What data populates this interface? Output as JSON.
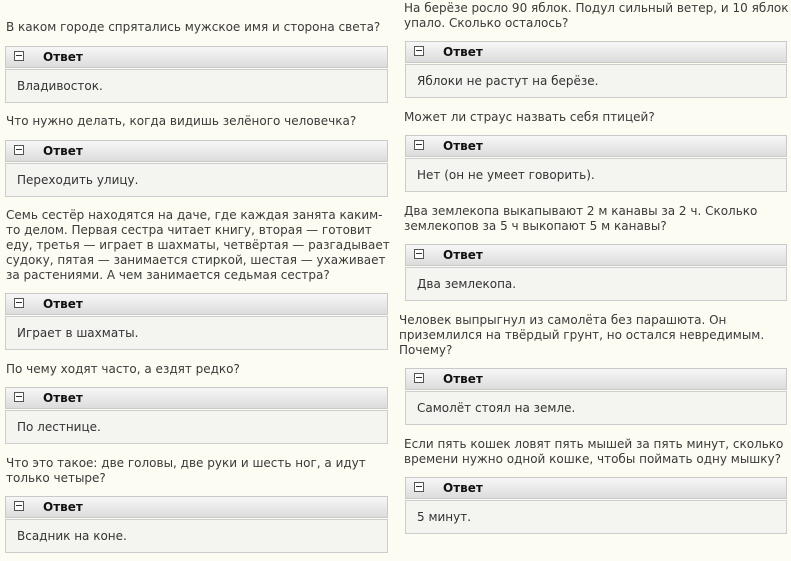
{
  "answer_label": "Ответ",
  "left": [
    {
      "question": "В каком городе спрятались мужское имя и сторона света?",
      "answer": "Владивосток."
    },
    {
      "question": "Что нужно делать, когда видишь зелёного человечка?",
      "answer": "Переходить улицу."
    },
    {
      "question": "Семь сестёр находятся на даче, где каждая занята каким-то делом. Первая сестра читает книгу, вторая — готовит еду, третья — играет в шахматы, четвёртая — разгадывает судоку, пятая — занимается стиркой, шестая — ухаживает за растениями. А чем занимается седьмая сестра?",
      "answer": "Играет в шахматы."
    },
    {
      "question": "По чему ходят часто, а ездят редко?",
      "answer": "По лестнице."
    },
    {
      "question": "Что это такое: две головы, две руки и шесть ног, а идут только четыре?",
      "answer": "Всадник на коне."
    }
  ],
  "right": [
    {
      "question": "На берёзе росло 90 яблок. Подул сильный ветер, и 10 яблок упало. Сколько осталось?",
      "answer": "Яблоки не растут на берёзе."
    },
    {
      "question": "Может ли страус назвать себя птицей?",
      "answer": "Нет (он не умеет говорить)."
    },
    {
      "question": "Два землекопа выкапывают 2 м канавы за 2 ч. Сколько землекопов за 5 ч выкопают 5 м канавы?",
      "answer": "Два землекопа."
    },
    {
      "question": "Человек выпрыгнул из самолёта без парашюта. Он приземлился на твёрдый грунт, но остался невредимым. Почему?",
      "answer": "Самолёт стоял на земле."
    },
    {
      "question": "Если пять кошек ловят пять мышей за пять минут, сколько времени нужно одной кошке, чтобы поймать одну мышку?",
      "answer": "5 минут."
    }
  ]
}
